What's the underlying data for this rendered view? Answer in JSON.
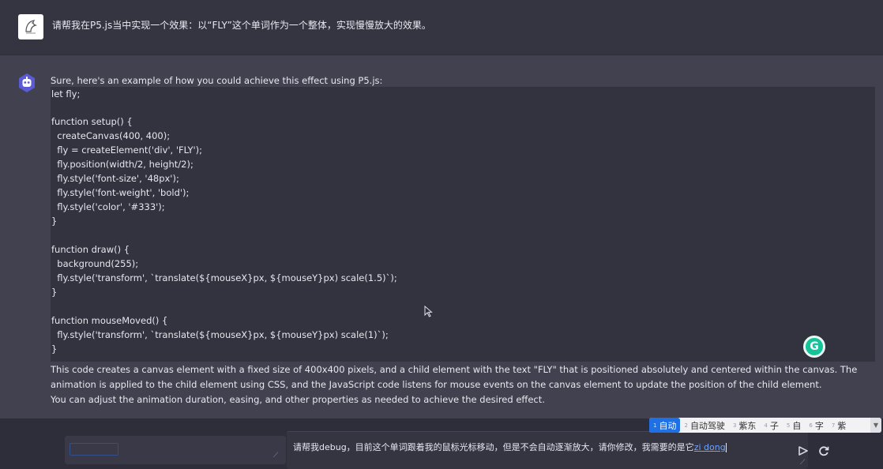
{
  "user_message": {
    "avatar_icon": "bird-sketch-icon",
    "text": "请帮我在P5.js当中实现一个效果：以“FLY”这个单词作为一个整体，实现慢慢放大的效果。"
  },
  "bot_message": {
    "avatar_icon": "robot-icon",
    "intro": "Sure, here's an example of how you could achieve this effect using P5.js:",
    "code_lines": [
      "let fly;",
      "",
      "function setup() {",
      "  createCanvas(400, 400);",
      "  fly = createElement('div', 'FLY');",
      "  fly.position(width/2, height/2);",
      "  fly.style('font-size', '48px');",
      "  fly.style('font-weight', 'bold');",
      "  fly.style('color', '#333');",
      "}",
      "",
      "function draw() {",
      "  background(255);",
      "  fly.style('transform', `translate(${mouseX}px, ${mouseY}px) scale(1.5)`);",
      "}",
      "",
      "function mouseMoved() {",
      "  fly.style('transform', `translate(${mouseX}px, ${mouseY}px) scale(1)`);",
      "}"
    ],
    "explanation": [
      "This code creates a canvas element with a fixed size of 400x400 pixels, and a child element with the text \"FLY\" that is positioned absolutely and centered within the canvas. The",
      "animation is applied to the child element using CSS, and the JavaScript code listens for mouse events on the canvas element to update the position of the child element.",
      "You can adjust the animation duration, easing, and other properties as needed to achieve the desired effect."
    ]
  },
  "grammarly_badge": "G",
  "composer": {
    "text": "请帮我debug，目前这个单词跟着我的鼠标光标移动，但是不会自动逐渐放大，请你修改，我需要的是它",
    "pinyin": "zi dong",
    "send_icon": "send-icon",
    "refresh_icon": "refresh-icon"
  },
  "ime": {
    "candidates": [
      {
        "num": "1",
        "text": "自动"
      },
      {
        "num": "2",
        "text": "自动驾驶"
      },
      {
        "num": "3",
        "text": "紫东"
      },
      {
        "num": "4",
        "text": "子"
      },
      {
        "num": "5",
        "text": "自"
      },
      {
        "num": "6",
        "text": "字"
      },
      {
        "num": "7",
        "text": "紫"
      }
    ],
    "selected_index": 0
  },
  "colors": {
    "page_bg": "#3a3a48",
    "code_bg": "#33333f",
    "ime_selected": "#1f6fe5",
    "grammarly": "#15c39a"
  }
}
